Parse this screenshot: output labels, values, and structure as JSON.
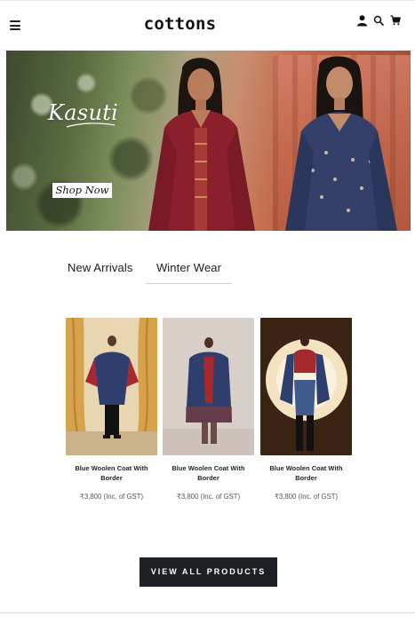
{
  "header": {
    "logo": "cottons",
    "icons": [
      "menu-icon",
      "user-icon",
      "search-icon",
      "cart-icon"
    ]
  },
  "hero": {
    "brand": "Kasuti",
    "cta_label": "Shop Now"
  },
  "tabs": [
    {
      "label": "New Arrivals",
      "active": false
    },
    {
      "label": "Winter Wear",
      "active": true
    }
  ],
  "products": [
    {
      "title": "Blue Woolen Coat With Border",
      "price": "₹3,800 (Inc. of GST)"
    },
    {
      "title": "Blue Woolen Coat With Border",
      "price": "₹3,800 (Inc. of GST)"
    },
    {
      "title": "Blue Woolen Coat With Border",
      "price": "₹3,800 (Inc. of GST)"
    }
  ],
  "cta": {
    "view_all_label": "VIEW ALL PRODUCTS"
  },
  "colors": {
    "header_bg": "#ffffff",
    "button_bg": "#1d2024",
    "button_text": "#ffffff",
    "coat_blue": "#2e3f6e",
    "accent_red": "#a5292e"
  }
}
